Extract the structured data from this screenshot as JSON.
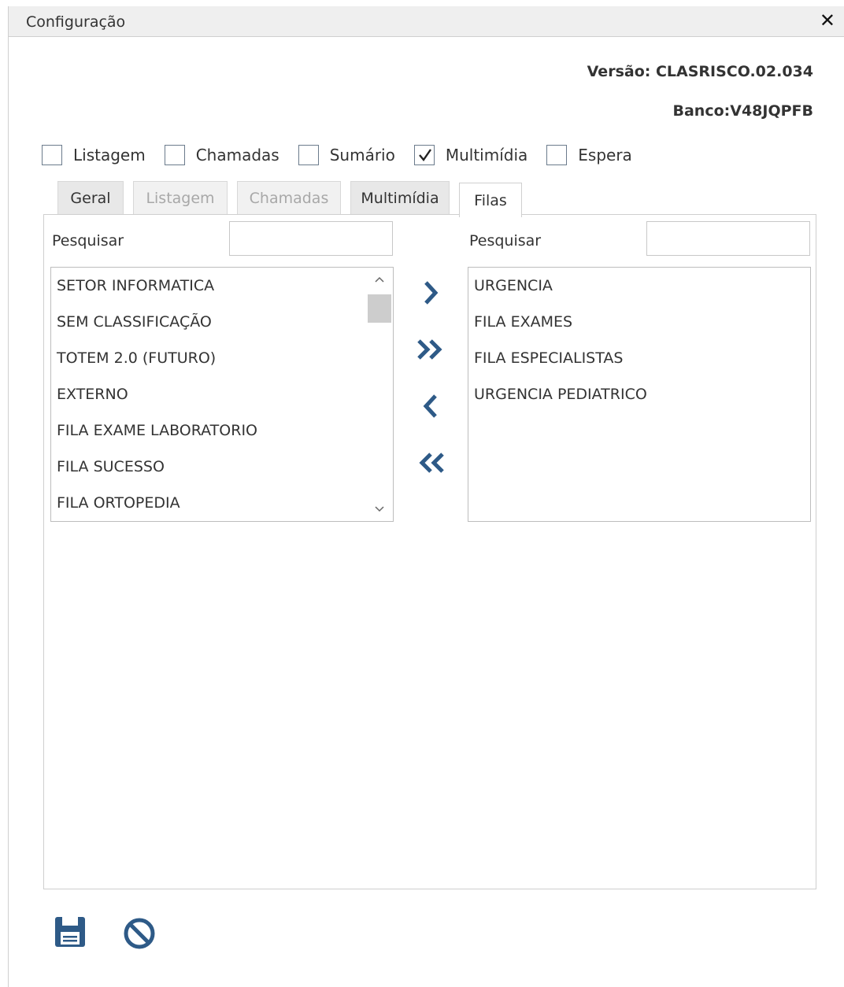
{
  "window": {
    "title": "Configuração",
    "close_icon": "close-icon"
  },
  "info": {
    "version": "Versão: CLASRISCO.02.034",
    "bank": "Banco:V48JQPFB"
  },
  "checkboxes": [
    {
      "label": "Listagem",
      "checked": false
    },
    {
      "label": "Chamadas",
      "checked": false
    },
    {
      "label": "Sumário",
      "checked": false
    },
    {
      "label": "Multimídia",
      "checked": true
    },
    {
      "label": "Espera",
      "checked": false
    }
  ],
  "tabs": [
    {
      "label": "Geral",
      "state": "normal"
    },
    {
      "label": "Listagem",
      "state": "disabled"
    },
    {
      "label": "Chamadas",
      "state": "disabled"
    },
    {
      "label": "Multimídia",
      "state": "normal"
    },
    {
      "label": "Filas",
      "state": "active"
    }
  ],
  "left": {
    "search_label": "Pesquisar",
    "search_value": "",
    "items": [
      "SETOR INFORMATICA",
      "SEM CLASSIFICAÇÃO",
      "TOTEM 2.0 (FUTURO)",
      "EXTERNO",
      "FILA EXAME LABORATORIO",
      "FILA SUCESSO",
      "FILA ORTOPEDIA"
    ]
  },
  "right": {
    "search_label": "Pesquisar",
    "search_value": "",
    "items": [
      "URGENCIA",
      "FILA EXAMES",
      "FILA ESPECIALISTAS",
      "URGENCIA PEDIATRICO"
    ]
  },
  "transfer_buttons": [
    "move-right-icon",
    "move-all-right-icon",
    "move-left-icon",
    "move-all-left-icon"
  ],
  "footer": {
    "save_icon": "save-icon",
    "cancel_icon": "cancel-icon"
  },
  "colors": {
    "accent": "#2e5a87",
    "titlebar": "#efefef",
    "border": "#cfcfcf"
  }
}
